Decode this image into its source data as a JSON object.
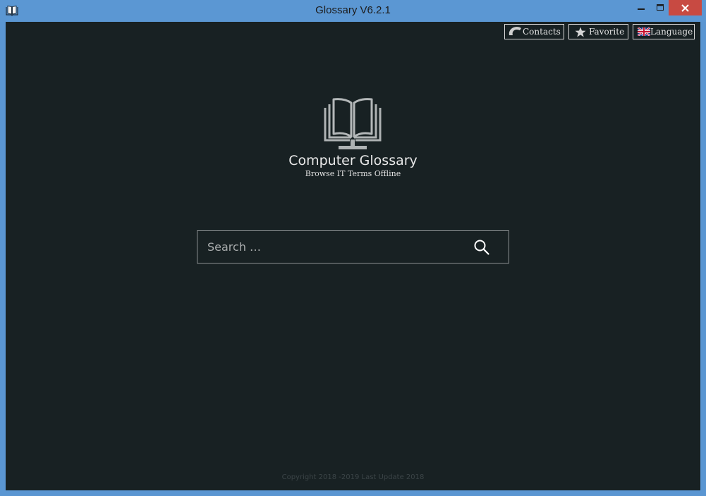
{
  "window": {
    "title": "Glossary V6.2.1"
  },
  "toolbar": {
    "contacts_label": "Contacts",
    "favorite_label": "Favorite",
    "language_label": "Language"
  },
  "hero": {
    "title": "Computer Glossary",
    "subtitle": "Browse IT Terms Offline"
  },
  "search": {
    "placeholder": "Search …",
    "value": ""
  },
  "footer": {
    "text": "Copyright 2018 -2019 Last Update 2018"
  },
  "icons": {
    "app": "book-icon",
    "contacts": "phone-icon",
    "favorite": "star-icon",
    "language": "uk-flag-icon",
    "logo": "open-book-icon",
    "search": "search-icon"
  },
  "colors": {
    "titlebar": "#5b97d3",
    "background": "#182123",
    "close_button": "#c84a42",
    "text": "#e8e8e8"
  }
}
